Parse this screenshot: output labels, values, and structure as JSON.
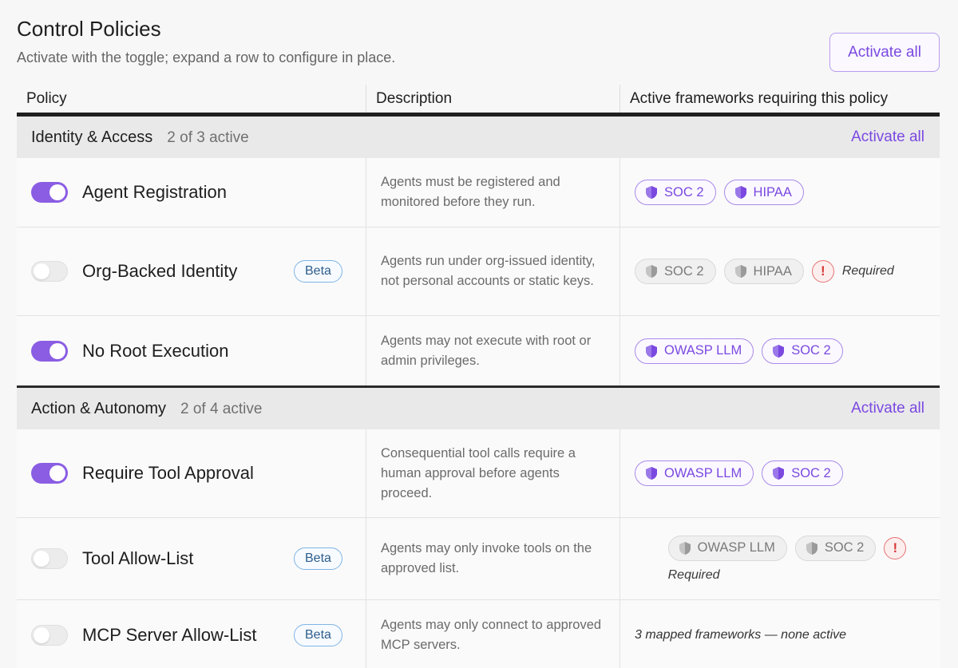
{
  "header": {
    "title": "Control Policies",
    "subtitle": "Activate with the toggle; expand a row to configure in place.",
    "activate_all": "Activate all"
  },
  "table": {
    "columns": [
      "Policy",
      "Description",
      "Active frameworks requiring this policy"
    ]
  },
  "groups": [
    {
      "name": "Identity & Access",
      "count": "2 of 3 active",
      "activate_all": "Activate all",
      "rows": [
        {
          "name": "Agent Registration",
          "active": true,
          "beta": "",
          "description": "Agents must be registered and monitored before they run.",
          "frameworks": [
            "SOC 2",
            "HIPAA"
          ],
          "required": ""
        },
        {
          "name": "Org-Backed Identity",
          "active": false,
          "beta": "Beta",
          "description": "Agents run under org-issued identity, not personal accounts or static keys.",
          "frameworks": [
            "SOC 2",
            "HIPAA"
          ],
          "required": "Required"
        },
        {
          "name": "No Root Execution",
          "active": true,
          "beta": "",
          "description": "Agents may not execute with root or admin privileges.",
          "frameworks": [
            "OWASP LLM",
            "SOC 2"
          ],
          "required": ""
        }
      ]
    },
    {
      "name": "Action & Autonomy",
      "count": "2 of 4 active",
      "activate_all": "Activate all",
      "rows": [
        {
          "name": "Require Tool Approval",
          "active": true,
          "beta": "",
          "description": "Consequential tool calls require a human approval before agents proceed.",
          "frameworks": [
            "OWASP LLM",
            "SOC 2"
          ],
          "required": ""
        },
        {
          "name": "Tool Allow-List",
          "active": false,
          "beta": "Beta",
          "description": "Agents may only invoke tools on the approved list.",
          "frameworks": [
            "OWASP LLM",
            "SOC 2"
          ],
          "required": "Required"
        },
        {
          "name": "MCP Server Allow-List",
          "active": false,
          "beta": "Beta",
          "description": "Agents may only connect to approved MCP servers.",
          "frameworks": [],
          "required": "",
          "note": "3 mapped frameworks — none active"
        }
      ]
    }
  ],
  "colors": {
    "accent": "#8a5de3",
    "accent_text": "#7b48e0",
    "beta_border": "#7fb4e6",
    "alert": "#d63838"
  },
  "icons": {
    "framework": "shield-icon",
    "alert": "exclamation-icon"
  }
}
